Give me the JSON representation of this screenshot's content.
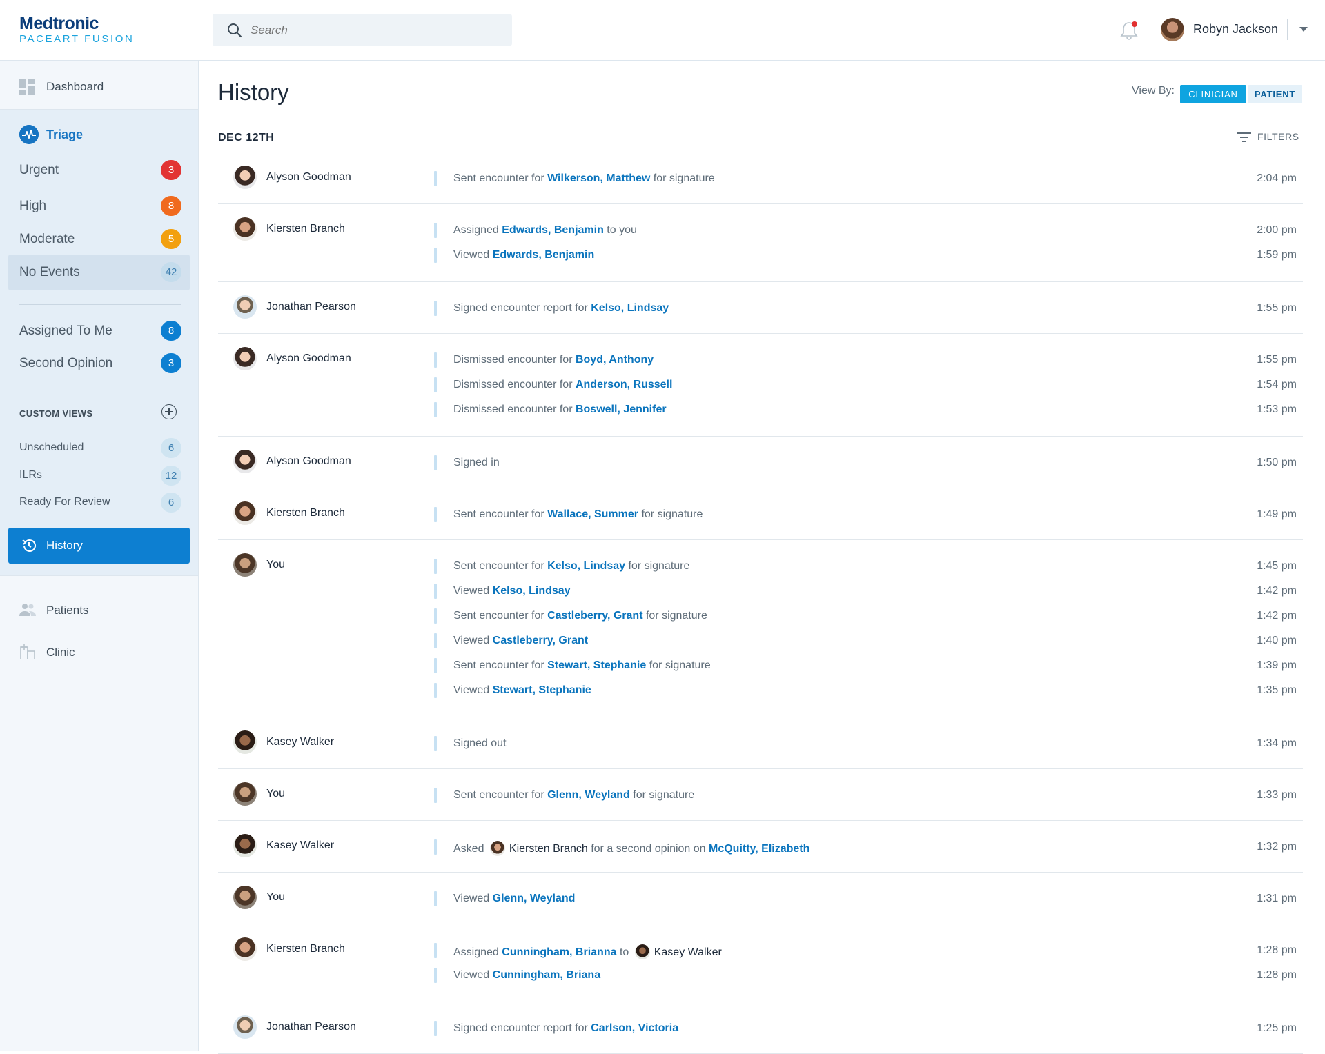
{
  "app": {
    "brand": "Medtronic",
    "product": "PACEART FUSION"
  },
  "search": {
    "placeholder": "Search"
  },
  "user": {
    "name": "Robyn Jackson"
  },
  "sidebar": {
    "dashboard": "Dashboard",
    "triage": "Triage",
    "triage_items": [
      {
        "label": "Urgent",
        "count": "3",
        "color": "#e23434"
      },
      {
        "label": "High",
        "count": "8",
        "color": "#f06a1e"
      },
      {
        "label": "Moderate",
        "count": "5",
        "color": "#f2a010"
      },
      {
        "label": "No Events",
        "count": "42",
        "color": "#cfe4f1"
      }
    ],
    "assigned": {
      "label": "Assigned To Me",
      "count": "8"
    },
    "second_opinion": {
      "label": "Second Opinion",
      "count": "3"
    },
    "custom_views_title": "CUSTOM VIEWS",
    "custom_views": [
      {
        "label": "Unscheduled",
        "count": "6"
      },
      {
        "label": "ILRs",
        "count": "12"
      },
      {
        "label": "Ready For Review",
        "count": "6"
      }
    ],
    "history": "History",
    "patients": "Patients",
    "clinic": "Clinic"
  },
  "main": {
    "title": "History",
    "view_by": "View By:",
    "view_clinician": "CLINICIAN",
    "view_patient": "PATIENT",
    "date": "DEC 12TH",
    "filters": "FILTERS"
  },
  "groups": [
    {
      "actor": "Alyson Goodman",
      "avatar": "f1",
      "events": [
        {
          "pre": "Sent encounter for ",
          "patient": "Wilkerson, Matthew",
          "post": " for signature",
          "time": "2:04 pm"
        }
      ]
    },
    {
      "actor": "Kiersten Branch",
      "avatar": "f2",
      "events": [
        {
          "pre": "Assigned ",
          "patient": "Edwards, Benjamin",
          "post": " to you",
          "time": "2:00 pm"
        },
        {
          "pre": "Viewed ",
          "patient": "Edwards, Benjamin",
          "post": "",
          "time": "1:59 pm"
        }
      ]
    },
    {
      "actor": "Jonathan Pearson",
      "avatar": "m1",
      "events": [
        {
          "pre": "Signed encounter report for ",
          "patient": "Kelso, Lindsay",
          "post": "",
          "time": "1:55 pm"
        }
      ]
    },
    {
      "actor": "Alyson Goodman",
      "avatar": "f1",
      "events": [
        {
          "pre": "Dismissed encounter for ",
          "patient": "Boyd, Anthony",
          "post": "",
          "time": "1:55 pm"
        },
        {
          "pre": "Dismissed encounter for ",
          "patient": "Anderson, Russell",
          "post": "",
          "time": "1:54 pm"
        },
        {
          "pre": "Dismissed encounter for ",
          "patient": "Boswell, Jennifer",
          "post": "",
          "time": "1:53 pm"
        }
      ]
    },
    {
      "actor": "Alyson Goodman",
      "avatar": "f1",
      "events": [
        {
          "pre": "Signed in",
          "patient": "",
          "post": "",
          "time": "1:50 pm"
        }
      ]
    },
    {
      "actor": "Kiersten Branch",
      "avatar": "f2",
      "events": [
        {
          "pre": "Sent encounter for ",
          "patient": "Wallace, Summer",
          "post": " for signature",
          "time": "1:49 pm"
        }
      ]
    },
    {
      "actor": "You",
      "avatar": "you",
      "events": [
        {
          "pre": "Sent encounter for ",
          "patient": "Kelso, Lindsay",
          "post": " for signature",
          "time": "1:45 pm"
        },
        {
          "pre": "Viewed ",
          "patient": "Kelso, Lindsay",
          "post": "",
          "time": "1:42 pm"
        },
        {
          "pre": "Sent encounter for ",
          "patient": "Castleberry, Grant",
          "post": " for signature",
          "time": "1:42 pm"
        },
        {
          "pre": "Viewed ",
          "patient": "Castleberry, Grant",
          "post": "",
          "time": "1:40 pm"
        },
        {
          "pre": "Sent encounter for ",
          "patient": "Stewart, Stephanie",
          "post": " for signature",
          "time": "1:39 pm"
        },
        {
          "pre": "Viewed ",
          "patient": "Stewart, Stephanie",
          "post": "",
          "time": "1:35 pm"
        }
      ]
    },
    {
      "actor": "Kasey Walker",
      "avatar": "kw",
      "events": [
        {
          "pre": "Signed out",
          "patient": "",
          "post": "",
          "time": "1:34 pm"
        }
      ]
    },
    {
      "actor": "You",
      "avatar": "you",
      "events": [
        {
          "pre": "Sent encounter for ",
          "patient": "Glenn, Weyland",
          "post": " for signature",
          "time": "1:33 pm"
        }
      ]
    },
    {
      "actor": "Kasey Walker",
      "avatar": "kw",
      "events": [
        {
          "pre": "Asked ",
          "peer": "Kiersten Branch",
          "peer_avatar": "f2",
          "mid": " for a second opinion on ",
          "patient": "McQuitty, Elizabeth",
          "post": "",
          "time": "1:32 pm"
        }
      ]
    },
    {
      "actor": "You",
      "avatar": "you",
      "events": [
        {
          "pre": "Viewed ",
          "patient": "Glenn, Weyland",
          "post": "",
          "time": "1:31 pm"
        }
      ]
    },
    {
      "actor": "Kiersten Branch",
      "avatar": "f2",
      "events": [
        {
          "pre": "Assigned ",
          "patient": "Cunningham, Brianna",
          "post": " to ",
          "peer": "Kasey Walker",
          "peer_avatar": "kw",
          "peer_after": true,
          "time": "1:28 pm"
        },
        {
          "pre": "Viewed ",
          "patient": "Cunningham, Briana",
          "post": "",
          "time": "1:28 pm"
        }
      ]
    },
    {
      "actor": "Jonathan Pearson",
      "avatar": "m1",
      "events": [
        {
          "pre": "Signed encounter report for ",
          "patient": "Carlson, Victoria",
          "post": "",
          "time": "1:25 pm"
        }
      ]
    }
  ]
}
